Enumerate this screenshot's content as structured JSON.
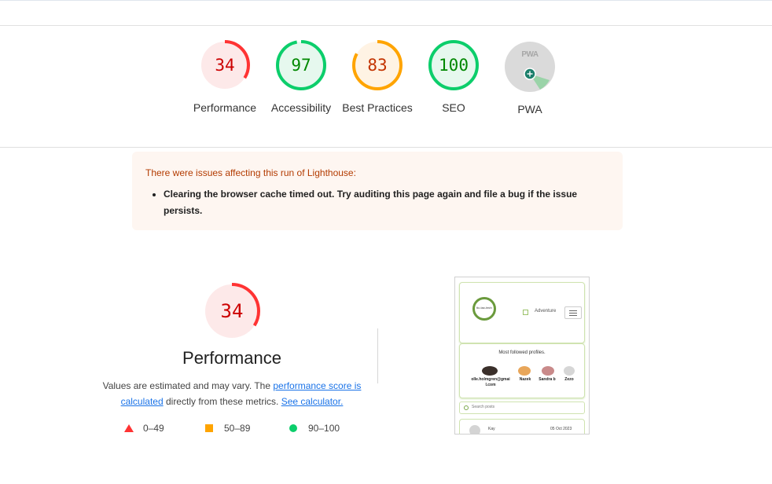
{
  "categories": [
    {
      "label": "Performance",
      "score": "34",
      "value": 34,
      "color": "#ff3333",
      "text_color": "#cc0000",
      "bg": "#fde9e9"
    },
    {
      "label": "Accessibility",
      "score": "97",
      "value": 97,
      "color": "#0cce6b",
      "text_color": "#008800",
      "bg": "#e6f8ee"
    },
    {
      "label": "Best Practices",
      "score": "83",
      "value": 83,
      "color": "#ffa400",
      "text_color": "#c33300",
      "bg": "#fff3e4"
    },
    {
      "label": "SEO",
      "score": "100",
      "value": 100,
      "color": "#0cce6b",
      "text_color": "#008800",
      "bg": "#e6f8ee"
    },
    {
      "label": "PWA",
      "badge": "PWA",
      "color": "#9e9e9e"
    }
  ],
  "warning": {
    "title": "There were issues affecting this run of Lighthouse:",
    "items": [
      "Clearing the browser cache timed out. Try auditing this page again and file a bug if the issue persists."
    ]
  },
  "performance": {
    "score": "34",
    "value": 34,
    "title": "Performance",
    "desc_pre": "Values are estimated and may vary. The ",
    "link1": "performance score is calculated",
    "desc_mid": " directly from these metrics. ",
    "link2": "See calculator."
  },
  "legend": [
    {
      "range": "0–49",
      "shape": "triangle",
      "color": "#ff3333"
    },
    {
      "range": "50–89",
      "shape": "square",
      "color": "#ffa400"
    },
    {
      "range": "90–100",
      "shape": "circle",
      "color": "#0cce6b"
    }
  ],
  "screenshot": {
    "nav_label": "Adventure",
    "logo_text": "tic-tac-tech",
    "most_followed": "Most followed profiles.",
    "profiles": [
      "olle.holmgren@gmai l.com",
      "Nazek",
      "Sandra b",
      "Zezo"
    ],
    "search_placeholder": "Search posts",
    "post_author": "Kay",
    "post_date": "05 Oct 2023"
  }
}
